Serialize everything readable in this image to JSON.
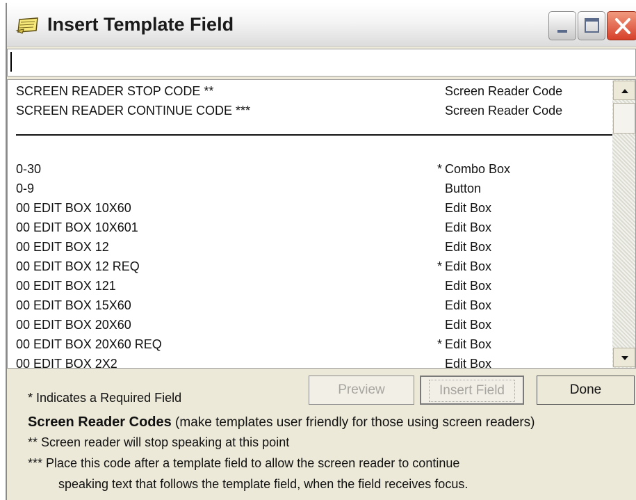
{
  "window": {
    "title": "Insert Template Field",
    "icon": "notepad-icon"
  },
  "title_buttons": {
    "minimize": "minimize-icon",
    "maximize": "maximize-icon",
    "close": "close-icon"
  },
  "search": {
    "value": ""
  },
  "list": {
    "items": [
      {
        "name": "SCREEN READER STOP CODE **",
        "required": "",
        "type": "Screen Reader Code"
      },
      {
        "name": "SCREEN READER CONTINUE CODE ***",
        "required": "",
        "type": "Screen Reader Code"
      },
      {
        "name": "0-30",
        "required": "*",
        "type": "Combo Box"
      },
      {
        "name": "0-9",
        "required": "",
        "type": "Button"
      },
      {
        "name": "00 EDIT BOX 10X60",
        "required": "",
        "type": "Edit Box"
      },
      {
        "name": "00 EDIT BOX 10X601",
        "required": "",
        "type": "Edit Box"
      },
      {
        "name": "00 EDIT BOX 12",
        "required": "",
        "type": "Edit Box"
      },
      {
        "name": "00 EDIT BOX 12 REQ",
        "required": "*",
        "type": "Edit Box"
      },
      {
        "name": "00 EDIT BOX 121",
        "required": "",
        "type": "Edit Box"
      },
      {
        "name": "00 EDIT BOX 15X60",
        "required": "",
        "type": "Edit Box"
      },
      {
        "name": "00 EDIT BOX 20X60",
        "required": "",
        "type": "Edit Box"
      },
      {
        "name": "00 EDIT BOX 20X60 REQ",
        "required": "*",
        "type": "Edit Box"
      },
      {
        "name": "00 EDIT BOX 2X2",
        "required": "",
        "type": "Edit Box"
      }
    ]
  },
  "buttons": {
    "preview": "Preview",
    "insert": "Insert Field",
    "done": "Done"
  },
  "legend": {
    "required": "* Indicates a Required Field",
    "codes_heading": "Screen Reader Codes",
    "codes_desc": "(make templates user friendly for those using screen readers)",
    "stop": "** Screen reader will stop speaking at this point",
    "continue_line1": "*** Place this code after a template field to allow the screen reader to continue",
    "continue_line2": "speaking text that follows the template field, when the field receives focus."
  }
}
